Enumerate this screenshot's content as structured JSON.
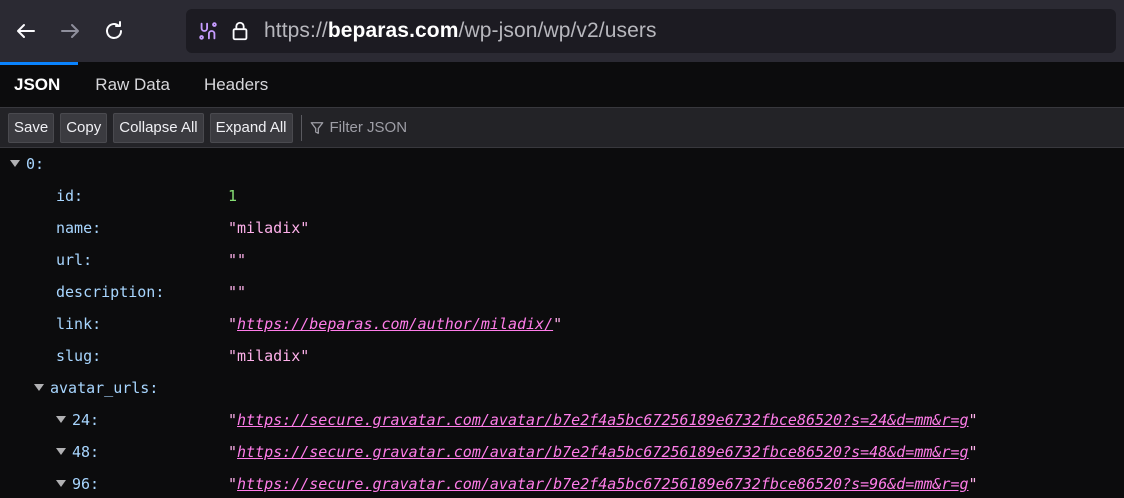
{
  "browser": {
    "url_protocol": "https://",
    "url_domain": "beparas.com",
    "url_path": "/wp-json/wp/v2/users"
  },
  "tabs": [
    {
      "label": "JSON",
      "active": true
    },
    {
      "label": "Raw Data",
      "active": false
    },
    {
      "label": "Headers",
      "active": false
    }
  ],
  "toolbar": {
    "save": "Save",
    "copy": "Copy",
    "collapse_all": "Collapse All",
    "expand_all": "Expand All",
    "filter_placeholder": "Filter JSON"
  },
  "tree": {
    "root_key": "0:",
    "id_key": "id:",
    "id_val": "1",
    "name_key": "name:",
    "name_val": "\"miladix\"",
    "url_key": "url:",
    "url_val": "\"\"",
    "description_key": "description:",
    "description_val": "\"\"",
    "link_key": "link:",
    "link_val": "https://beparas.com/author/miladix/",
    "slug_key": "slug:",
    "slug_val": "\"miladix\"",
    "avatar_urls_key": "avatar_urls:",
    "avatars": [
      {
        "key": "24:",
        "val": "https://secure.gravatar.com/avatar/b7e2f4a5bc67256189e6732fbce86520?s=24&d=mm&r=g"
      },
      {
        "key": "48:",
        "val": "https://secure.gravatar.com/avatar/b7e2f4a5bc67256189e6732fbce86520?s=48&d=mm&r=g"
      },
      {
        "key": "96:",
        "val": "https://secure.gravatar.com/avatar/b7e2f4a5bc67256189e6732fbce86520?s=96&d=mm&r=g"
      }
    ]
  },
  "colors": {
    "key": "#a8d6ff",
    "number": "#86de74",
    "string": "#ffb1eb",
    "link": "#ff7de9",
    "accent": "#0a84ff"
  }
}
